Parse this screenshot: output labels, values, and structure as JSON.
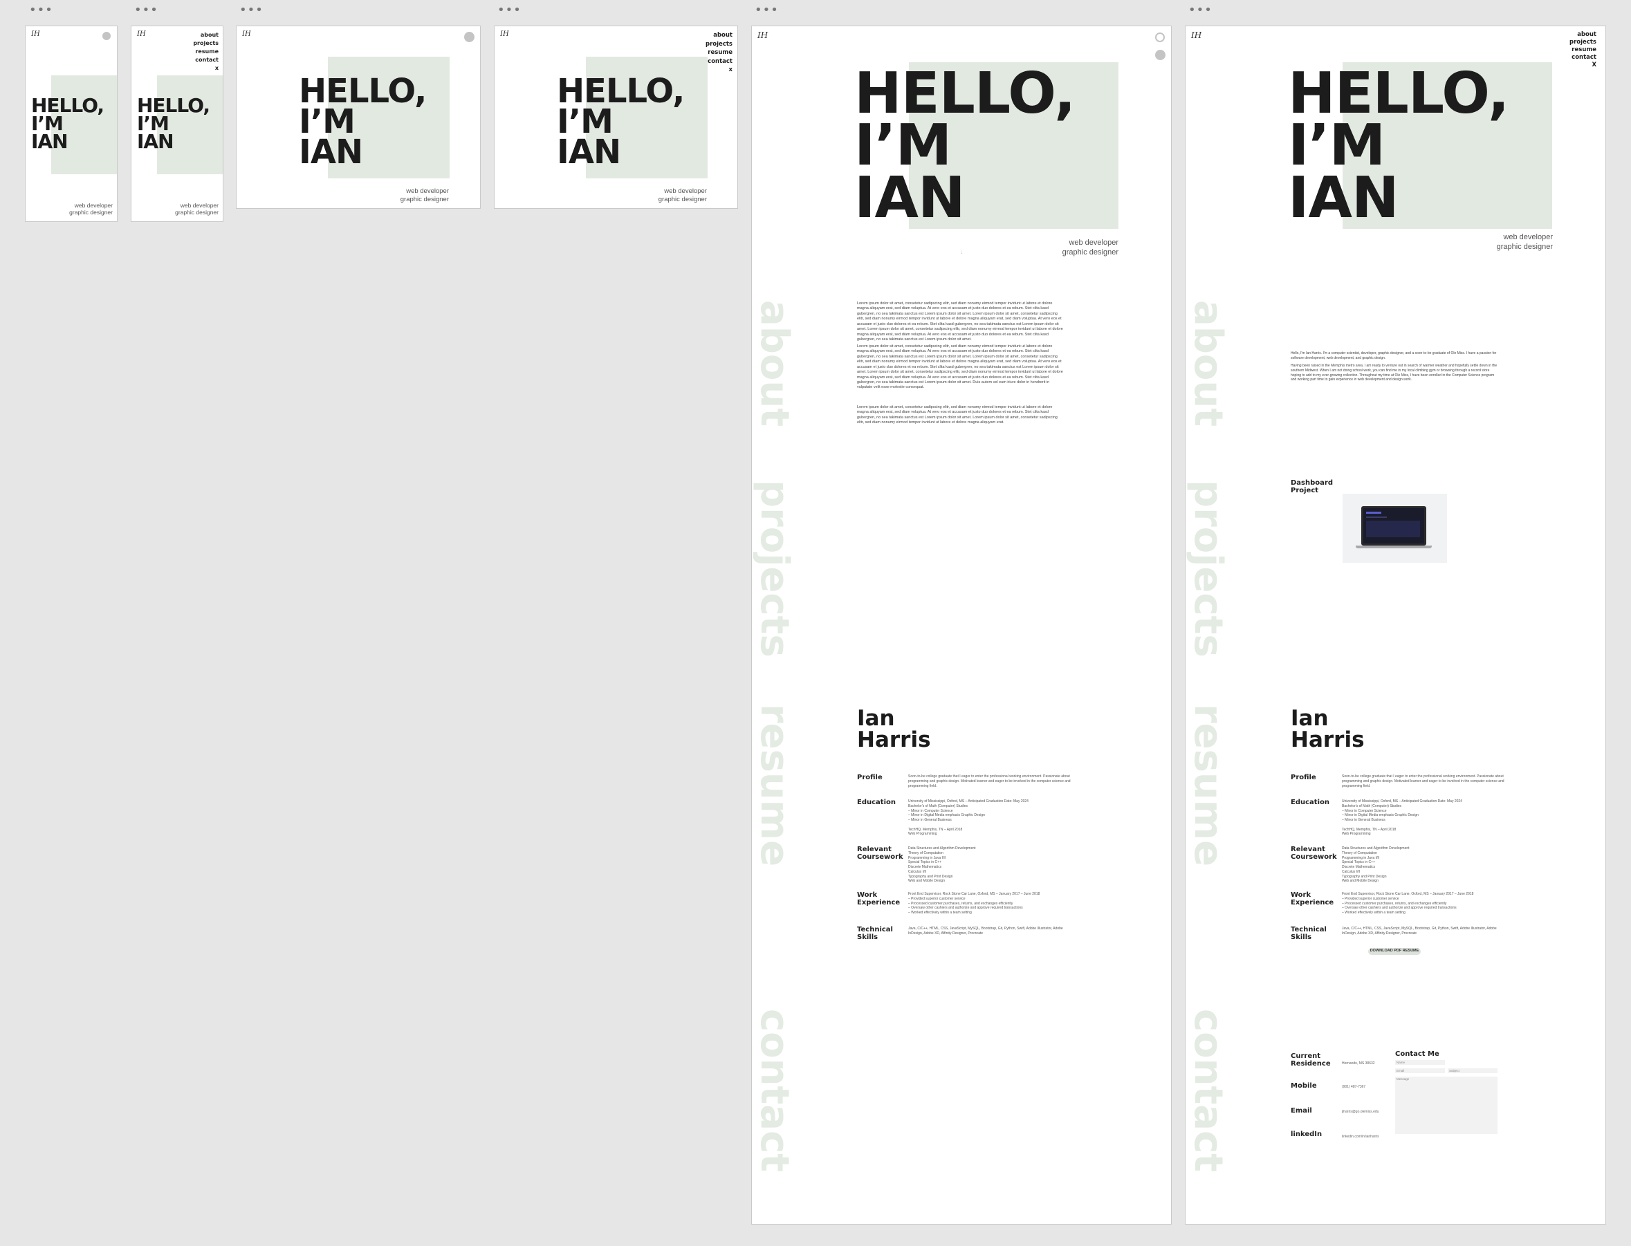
{
  "artboard_menu": "•••",
  "logo_text": "IH",
  "hero": {
    "hello": "HELLO,",
    "im": "I’M",
    "name": "IAN",
    "role1": "web developer",
    "role2": "graphic designer"
  },
  "nav": {
    "about": "about",
    "projects": "projects",
    "resume": "resume",
    "contact": "contact",
    "close": "x",
    "close_large": "X"
  },
  "sections": {
    "about": "about",
    "projects": "projects",
    "resume": "resume",
    "contact": "contact"
  },
  "about": {
    "lorem1": "Lorem ipsum dolor sit amet, consetetur sadipscing elitr, sed diam nonumy eirmod tempor invidunt ut labore et dolore magna aliquyam erat, sed diam voluptua. At vero eos et accusam et justo duo dolores et ea rebum. Stet clita kasd gubergren, no sea takimata sanctus est Lorem ipsum dolor sit amet. Lorem ipsum dolor sit amet, consetetur sadipscing elitr, sed diam nonumy eirmod tempor invidunt ut labore et dolore magna aliquyam erat, sed diam voluptua. At vero eos et accusam et justo duo dolores et ea rebum. Stet clita kasd gubergren, no sea takimata sanctus est Lorem ipsum dolor sit amet. Lorem ipsum dolor sit amet, consetetur sadipscing elitr, sed diam nonumy eirmod tempor invidunt ut labore et dolore magna aliquyam erat, sed diam voluptua. At vero eos et accusam et justo duo dolores et ea rebum. Stet clita kasd gubergren, no sea takimata sanctus est Lorem ipsum dolor sit amet.",
    "lorem2": "Lorem ipsum dolor sit amet, consetetur sadipscing elitr, sed diam nonumy eirmod tempor invidunt ut labore et dolore magna aliquyam erat, sed diam voluptua. At vero eos et accusam et justo duo dolores et ea rebum. Stet clita kasd gubergren, no sea takimata sanctus est Lorem ipsum dolor sit amet. Lorem ipsum dolor sit amet, consetetur sadipscing elitr, sed diam nonumy eirmod tempor invidunt ut labore et dolore magna aliquyam erat, sed diam voluptua. At vero eos et accusam et justo duo dolores et ea rebum. Stet clita kasd gubergren, no sea takimata sanctus est Lorem ipsum dolor sit amet. Lorem ipsum dolor sit amet, consetetur sadipscing elitr, sed diam nonumy eirmod tempor invidunt ut labore et dolore magna aliquyam erat, sed diam voluptua. At vero eos et accusam et justo duo dolores et ea rebum. Stet clita kasd gubergren, no sea takimata sanctus est Lorem ipsum dolor sit amet. Duis autem vel eum iriure dolor in hendrerit in vulputate velit esse molestie consequat.",
    "lorem3": "Lorem ipsum dolor sit amet, consetetur sadipscing elitr, sed diam nonumy eirmod tempor invidunt ut labore et dolore magna aliquyam erat, sed diam voluptua. At vero eos et accusam et justo duo dolores et ea rebum. Stet clita kasd gubergren, no sea takimata sanctus est Lorem ipsum dolor sit amet. Lorem ipsum dolor sit amet, consetetur sadipscing elitr, sed diam nonumy eirmod tempor invidunt ut labore et dolore magna aliquyam erat.",
    "bio1": "Hello, I'm Ian Harris. I'm a computer scientist, developer, graphic designer, and a soon-to-be graduate of Ole Miss. I have a passion for software development, web development, and graphic design.",
    "bio2": "Having been raised in the Memphis metro area, I am ready to venture out in search of warmer weather and hopefully settle down in the southern Midwest. When I am not doing school work, you can find me in my local climbing gym or browsing through a record store hoping to add to my ever-growing collection. Throughout my time at Ole Miss, I have been enrolled in the Computer Science program and working part time to gain experience in web development and design work."
  },
  "projects": {
    "item_title": "Dashboard\nProject"
  },
  "resume": {
    "name": "Ian\nHarris",
    "profile_label": "Profile",
    "profile_text": "Soon-to-be college graduate that I eager to enter the professional working environment. Passionate about\nprogramming and graphic design. Motivated learner and eager to be involved in the computer science and\nprogramming field.",
    "education_label": "Education",
    "education_text": "University of Mississippi, Oxford, MS – Anticipated Graduation Date: May 2024\nBachelor's of Math (Computer) Studies\n– Minor in Computer Science\n– Minor in Digital Media emphasis Graphic Design\n– Minor in General Business\n\nTechHQ, Memphis, TN – April 2018\nWeb Programming",
    "coursework_label": "Relevant\nCoursework",
    "coursework_text": "Data Structures and Algorithm Development\nTheory of Computation\nProgramming in Java I/II\nSpecial Topics in C++\nDiscrete Mathematics\nCalculus I/II\nTypography and Print Design\nWeb and Mobile Design",
    "work_label": "Work\nExperience",
    "work_text": "Front End Supervisor, Rock Stone Car Lane, Oxford, MS – January 2017 – June 2018\n– Provided superior customer service\n– Processed customer purchases, returns, and exchanges efficiently\n– Oversaw other cashiers and authorize and approve required transactions\n– Worked effectively within a team setting",
    "skills_label": "Technical\nSkills",
    "skills_text": "Java, C/C++, HTML, CSS, JavaScript, MySQL, Bootstrap, Git, Python, Swift, Adobe Illustrator, Adobe\nInDesign, Adobe XD, Affinity Designer, Procreate",
    "download": "DOWNLOAD PDF RESUME"
  },
  "contact": {
    "residence_label": "Current\nResidence",
    "residence_value": "Hernando, MS 38632",
    "mobile_label": "Mobile",
    "mobile_value": "(901) 487-7367",
    "email_label": "Email",
    "email_value": "jiharris@go.olemiss.edu",
    "linkedin_label": "linkedIn",
    "linkedin_value": "linkedin.com/in/ianharris",
    "form_title": "Contact Me",
    "name_placeholder": "Name",
    "email_placeholder": "Email",
    "subject_placeholder": "Subject",
    "message_placeholder": "Message"
  },
  "colors": {
    "canvas": "#e6e6e6",
    "accent_green": "#e2e9e1",
    "section_text": "#e3ebe2",
    "dark_text": "#1c1c1c"
  }
}
